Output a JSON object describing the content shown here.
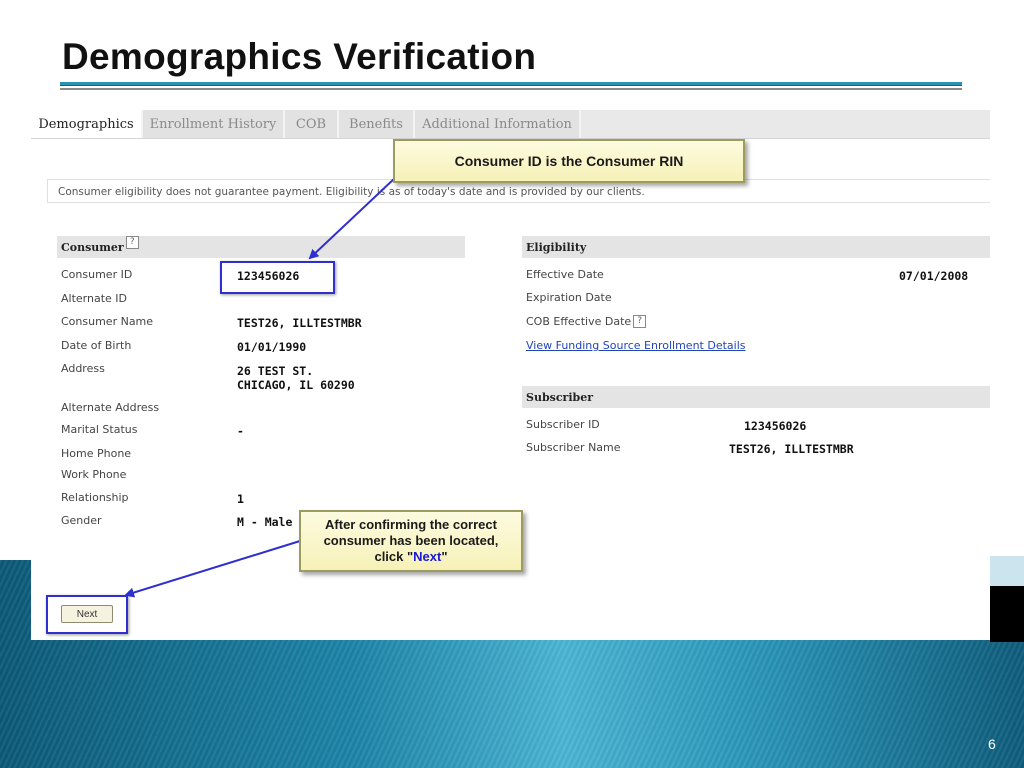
{
  "slide": {
    "title": "Demographics Verification",
    "page_number": "6"
  },
  "tabs": [
    {
      "label": "Demographics",
      "active": true
    },
    {
      "label": "Enrollment History",
      "active": false
    },
    {
      "label": "COB",
      "active": false
    },
    {
      "label": "Benefits",
      "active": false
    },
    {
      "label": "Additional Information",
      "active": false
    }
  ],
  "disclaimer": "Consumer eligibility does not guarantee payment. Eligibility is as of today's date and is provided by our clients.",
  "consumer": {
    "header": "Consumer",
    "help_icon": "?",
    "fields": {
      "consumer_id_label": "Consumer ID",
      "consumer_id": "123456026",
      "alternate_id_label": "Alternate ID",
      "consumer_name_label": "Consumer Name",
      "consumer_name": "TEST26, ILLTESTMBR",
      "dob_label": "Date of Birth",
      "dob": "01/01/1990",
      "address_label": "Address",
      "address_line1": "26 TEST ST.",
      "address_line2": "CHICAGO, IL 60290",
      "alt_address_label": "Alternate Address",
      "marital_label": "Marital Status",
      "marital": "-",
      "home_phone_label": "Home Phone",
      "work_phone_label": "Work Phone",
      "relationship_label": "Relationship",
      "relationship": "1",
      "gender_label": "Gender",
      "gender": "M - Male"
    }
  },
  "eligibility": {
    "header": "Eligibility",
    "effective_date_label": "Effective Date",
    "effective_date": "07/01/2008",
    "expiration_date_label": "Expiration Date",
    "cob_effective_label": "COB Effective Date",
    "help_icon": "?",
    "funding_link": "View Funding Source Enrollment Details"
  },
  "subscriber": {
    "header": "Subscriber",
    "id_label": "Subscriber ID",
    "id": "123456026",
    "name_label": "Subscriber Name",
    "name": "TEST26, ILLTESTMBR"
  },
  "next_button": "Next",
  "callouts": {
    "consumer_id": "Consumer ID is the Consumer RIN",
    "next_line1": "After confirming the correct",
    "next_line2": "consumer has been located,",
    "next_line3_pre": "click \"",
    "next_word": "Next",
    "next_line3_post": "\""
  },
  "colors": {
    "highlight_box": "#2f2fd0",
    "title_rule": "#2c8fb4",
    "callout_bg": "#f6f1b8",
    "link": "#2244bb"
  }
}
